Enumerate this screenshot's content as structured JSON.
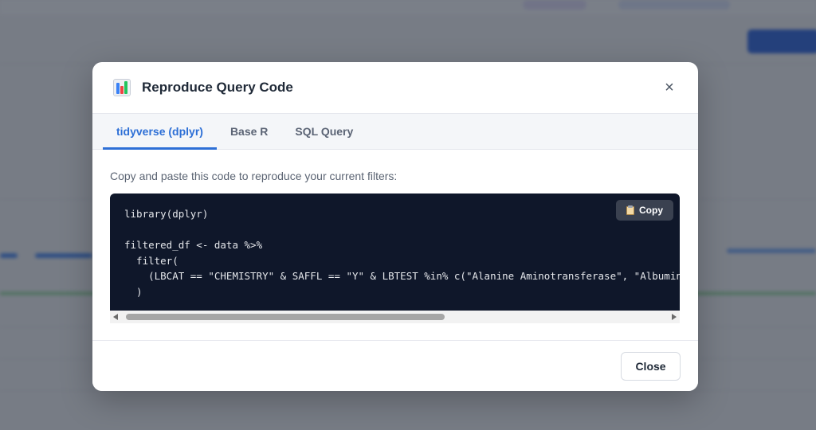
{
  "modal": {
    "title": "Reproduce Query Code",
    "close_icon": "×",
    "tabs": [
      {
        "label": "tidyverse (dplyr)",
        "active": true
      },
      {
        "label": "Base R",
        "active": false
      },
      {
        "label": "SQL Query",
        "active": false
      }
    ],
    "instruction": "Copy and paste this code to reproduce your current filters:",
    "code_lines": [
      "library(dplyr)",
      "",
      "filtered_df <- data %>%",
      "  filter(",
      "    (LBCAT == \"CHEMISTRY\" & SAFFL == \"Y\" & LBTEST %in% c(\"Alanine Aminotransferase\", \"Albumin\", \"A",
      "  )"
    ],
    "copy_label": "Copy",
    "close_label": "Close"
  },
  "colors": {
    "accent": "#2d6fd6",
    "code_background": "#0f172a",
    "overlay": "rgba(28, 34, 48, 0.55)"
  },
  "icons": {
    "title_icon": "bar-chart-icon",
    "copy_icon": "clipboard-icon",
    "close_icon": "close-icon"
  }
}
